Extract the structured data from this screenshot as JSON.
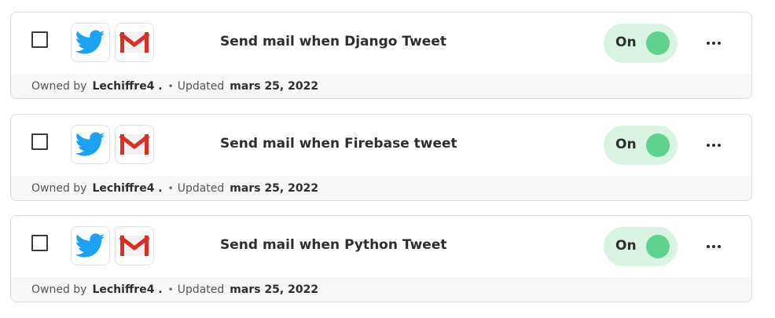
{
  "colors": {
    "toggle_bg": "#d9f3e2",
    "toggle_knob": "#5fd38d",
    "twitter_blue": "#1da1f2",
    "gmail_red": "#d93025"
  },
  "zaps": [
    {
      "title": "Send mail when Django Tweet",
      "status_label": "On",
      "owned_by_label": "Owned by",
      "owner": "Lechiffre4 .",
      "separator": "•",
      "updated_label": "Updated",
      "updated_date": "mars 25, 2022",
      "apps": [
        "twitter-icon",
        "gmail-icon"
      ]
    },
    {
      "title": "Send mail when Firebase tweet",
      "status_label": "On",
      "owned_by_label": "Owned by",
      "owner": "Lechiffre4 .",
      "separator": "•",
      "updated_label": "Updated",
      "updated_date": "mars 25, 2022",
      "apps": [
        "twitter-icon",
        "gmail-icon"
      ]
    },
    {
      "title": "Send mail when Python Tweet",
      "status_label": "On",
      "owned_by_label": "Owned by",
      "owner": "Lechiffre4 .",
      "separator": "•",
      "updated_label": "Updated",
      "updated_date": "mars 25, 2022",
      "apps": [
        "twitter-icon",
        "gmail-icon"
      ]
    }
  ]
}
